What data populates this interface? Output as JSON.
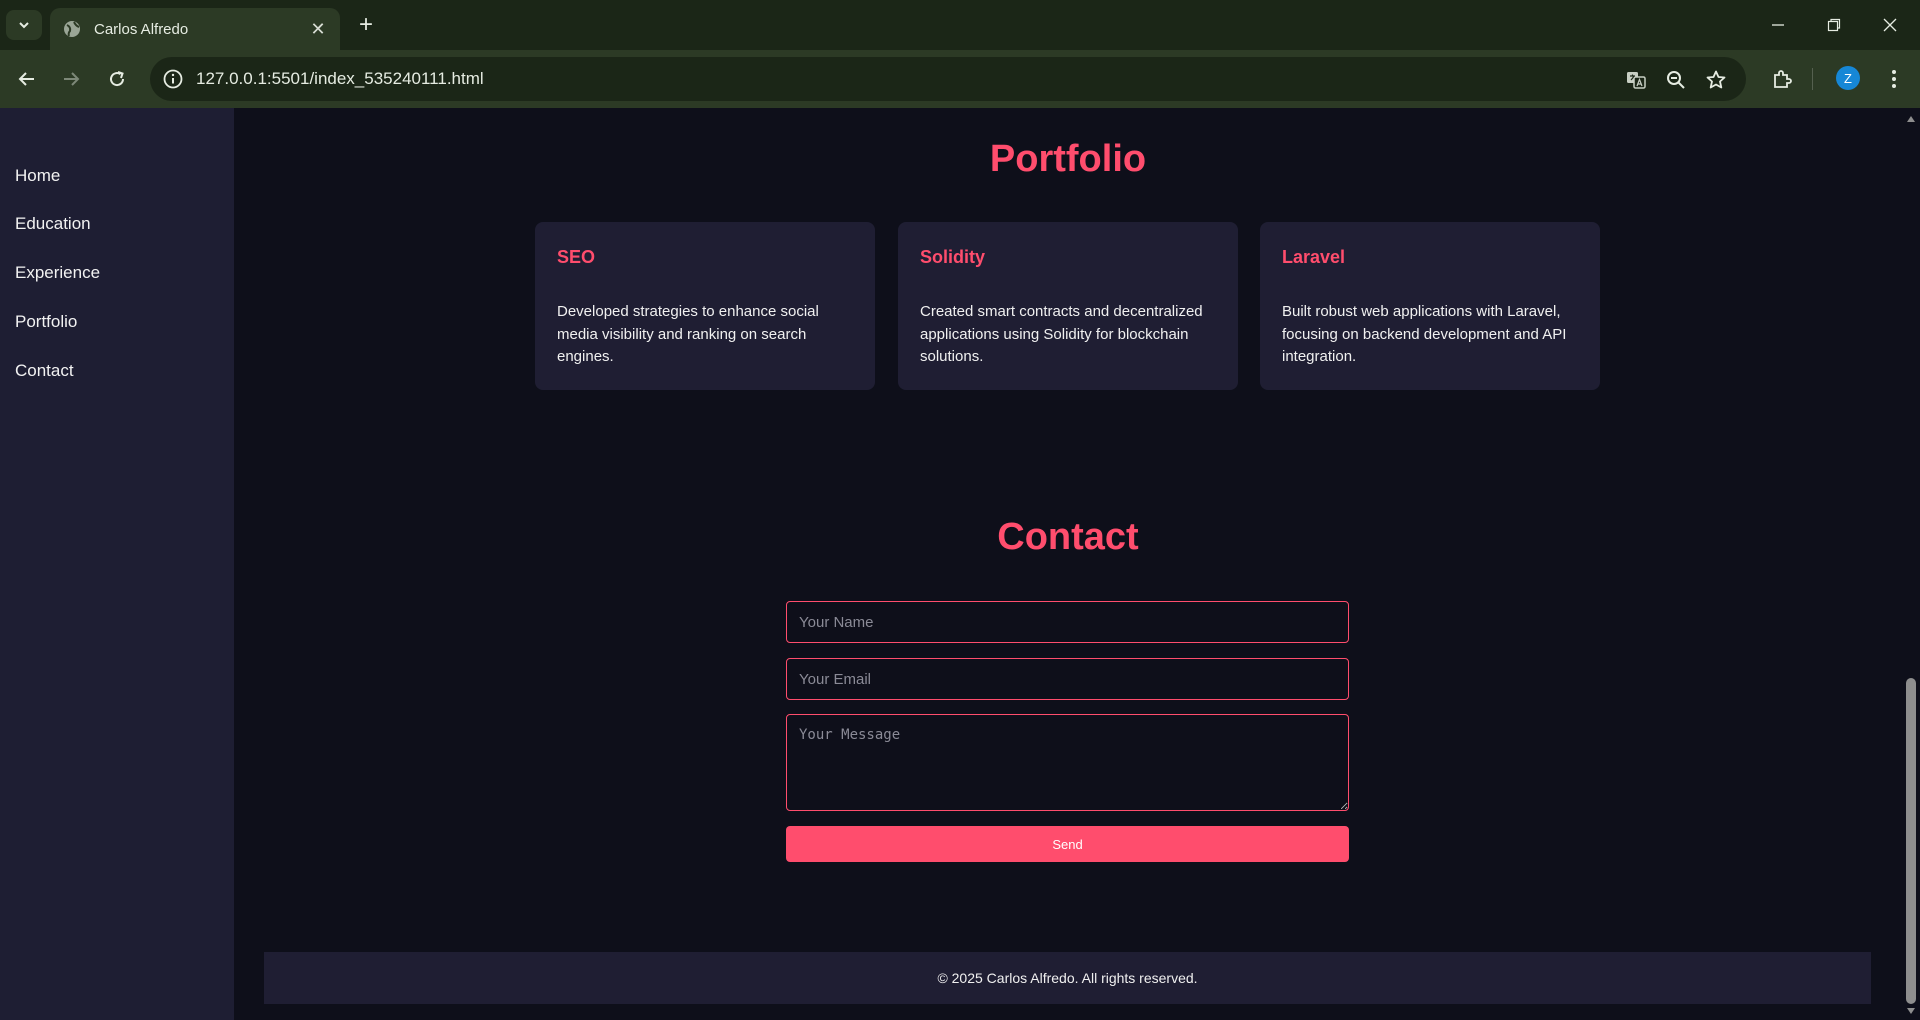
{
  "browser": {
    "tab_title": "Carlos Alfredo",
    "tab_close": "✕",
    "new_tab": "+",
    "url": "127.0.0.1:5501/index_535240111.html",
    "profile_initial": "Z",
    "avatar_color": "#1687d6"
  },
  "sidebar": {
    "items": [
      {
        "label": "Home"
      },
      {
        "label": "Education"
      },
      {
        "label": "Experience"
      },
      {
        "label": "Portfolio"
      },
      {
        "label": "Contact"
      }
    ]
  },
  "portfolio": {
    "title": "Portfolio",
    "cards": [
      {
        "title": "SEO",
        "description": "Developed strategies to enhance social media visibility and ranking on search engines."
      },
      {
        "title": "Solidity",
        "description": "Created smart contracts and decentralized applications using Solidity for blockchain solutions."
      },
      {
        "title": "Laravel",
        "description": "Built robust web applications with Laravel, focusing on backend development and API integration."
      }
    ]
  },
  "contact": {
    "title": "Contact",
    "name_placeholder": "Your Name",
    "email_placeholder": "Your Email",
    "message_placeholder": "Your Message",
    "send_label": "Send"
  },
  "footer": {
    "text": "© 2025 Carlos Alfredo. All rights reserved."
  },
  "colors": {
    "accent": "#ff4d6d",
    "page_bg": "#0e0f1a",
    "sidebar_bg": "#1e1e33",
    "card_bg": "#1f1e33",
    "browser_frame": "#1b2617"
  }
}
